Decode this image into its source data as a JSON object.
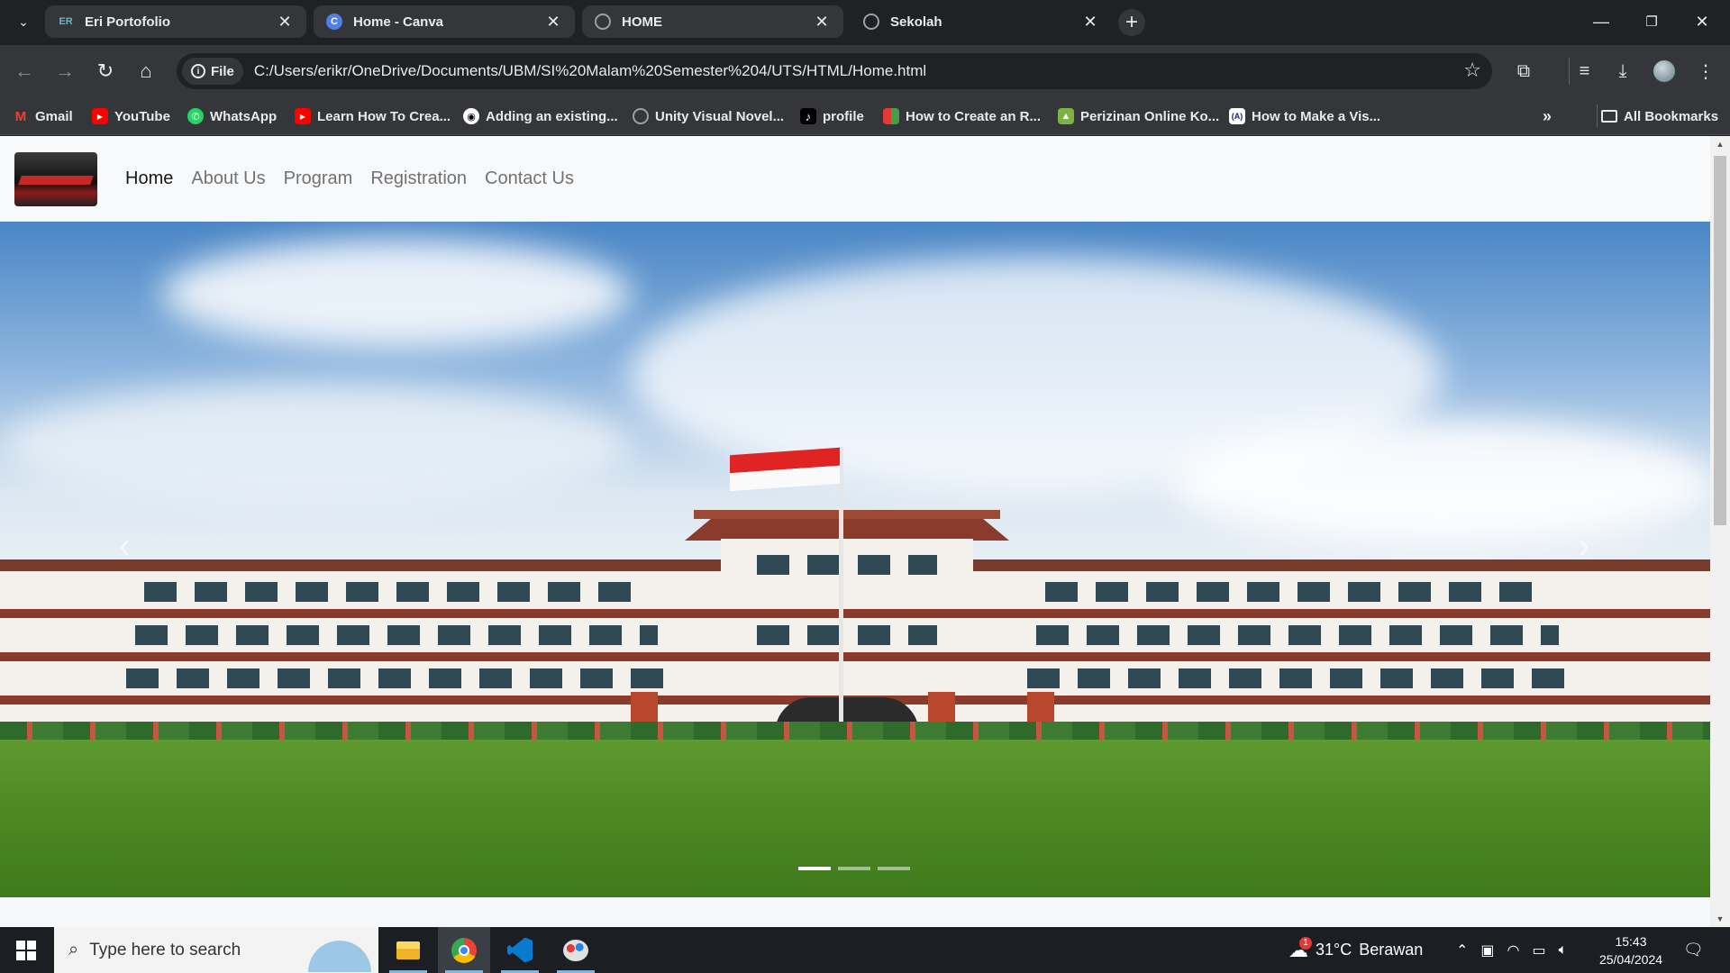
{
  "browser": {
    "tabs": [
      {
        "title": "Eri Portofolio",
        "favicon": "eri-portfolio-favicon",
        "active": false
      },
      {
        "title": "Home - Canva",
        "favicon": "canva-favicon",
        "active": false
      },
      {
        "title": "HOME",
        "favicon": "globe-favicon",
        "active": false
      },
      {
        "title": "Sekolah",
        "favicon": "globe-favicon",
        "active": true
      }
    ],
    "address": {
      "scheme_chip": "File",
      "url": "C:/Users/erikr/OneDrive/Documents/UBM/SI%20Malam%20Semester%204/UTS/HTML/Home.html"
    },
    "bookmarks": [
      {
        "label": "Gmail",
        "icon": "gmail-icon",
        "color": "#ea4335"
      },
      {
        "label": "YouTube",
        "icon": "youtube-icon",
        "color": "#ff0000"
      },
      {
        "label": "WhatsApp",
        "icon": "whatsapp-icon",
        "color": "#25d366"
      },
      {
        "label": "Learn How To Crea...",
        "icon": "youtube-icon",
        "color": "#ff0000"
      },
      {
        "label": "Adding an existing...",
        "icon": "github-icon",
        "color": "#ffffff"
      },
      {
        "label": "Unity Visual Novel...",
        "icon": "globe-icon",
        "color": "#9aa0a6"
      },
      {
        "label": "profile",
        "icon": "tiktok-icon",
        "color": "#000000"
      },
      {
        "label": "How to Create an R...",
        "icon": "bookmark-site-icon",
        "color": "#e53935"
      },
      {
        "label": "Perizinan Online Ko...",
        "icon": "government-icon",
        "color": "#7cb342"
      },
      {
        "label": "How to Make a Vis...",
        "icon": "site-icon",
        "color": "#1a237e"
      }
    ],
    "all_bookmarks_label": "All Bookmarks"
  },
  "page": {
    "logo_alt": "school-logo",
    "nav": [
      {
        "label": "Home",
        "active": true
      },
      {
        "label": "About Us",
        "active": false
      },
      {
        "label": "Program",
        "active": false
      },
      {
        "label": "Registration",
        "active": false
      },
      {
        "label": "Contact Us",
        "active": false
      }
    ],
    "carousel": {
      "slide_count": 3,
      "active_index": 0
    }
  },
  "taskbar": {
    "search_placeholder": "Type here to search",
    "weather": {
      "temp": "31°C",
      "condition": "Berawan",
      "badge": "1"
    },
    "time": "15:43",
    "date": "25/04/2024"
  },
  "colors": {
    "chrome_dark": "#202124",
    "chrome_toolbar": "#35363a",
    "navbar_bg": "#f8f9fa",
    "taskbar_bg": "#1b1f24"
  }
}
